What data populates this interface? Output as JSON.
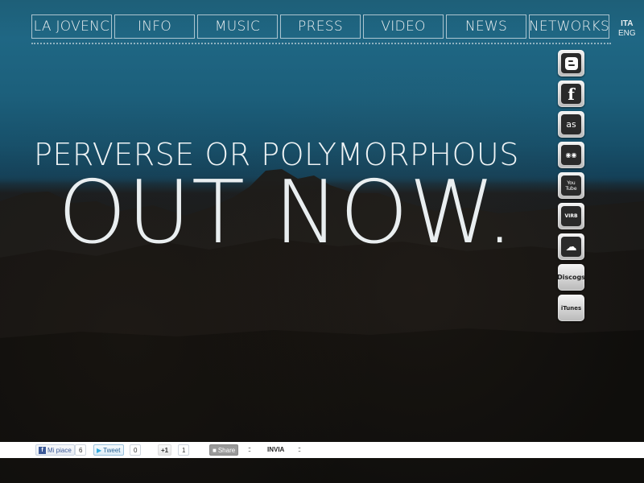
{
  "nav": {
    "items": [
      {
        "label": "LA JOVENC",
        "width": 100
      },
      {
        "label": "INFO",
        "width": 100
      },
      {
        "label": "MUSIC",
        "width": 100
      },
      {
        "label": "PRESS",
        "width": 100
      },
      {
        "label": "VIDEO",
        "width": 100
      },
      {
        "label": "NEWS",
        "width": 100
      },
      {
        "label": "NETWORKS",
        "width": 100
      }
    ]
  },
  "language": {
    "ita": "ITA",
    "eng": "ENG"
  },
  "hero": {
    "subtitle": "PERVERSE OR POLYMORPHOUS",
    "headline": "OUT NOW."
  },
  "social": [
    {
      "name": "blogger",
      "glyph": "B"
    },
    {
      "name": "facebook",
      "glyph": "f"
    },
    {
      "name": "lastfm",
      "glyph": "as"
    },
    {
      "name": "myspace",
      "glyph": "◉◉"
    },
    {
      "name": "youtube",
      "glyph": "You Tube"
    },
    {
      "name": "virb",
      "glyph": "VIRB"
    },
    {
      "name": "soundcloud",
      "glyph": "☁"
    },
    {
      "name": "discogs",
      "glyph": "Discogs"
    },
    {
      "name": "itunes",
      "glyph": " iTunes"
    }
  ],
  "sharebar": {
    "like_label": "Mi piace",
    "like_count": "6",
    "tweet_label": "Tweet",
    "tweet_count": "0",
    "plusone_label": "+1",
    "plusone_count": "1",
    "share_label": "Share",
    "invia_label": "INVIA",
    "dots": "::"
  },
  "colors": {
    "sky_top": "#1f6784",
    "ground": "#0e0e0e",
    "text": "#e8eef0"
  }
}
